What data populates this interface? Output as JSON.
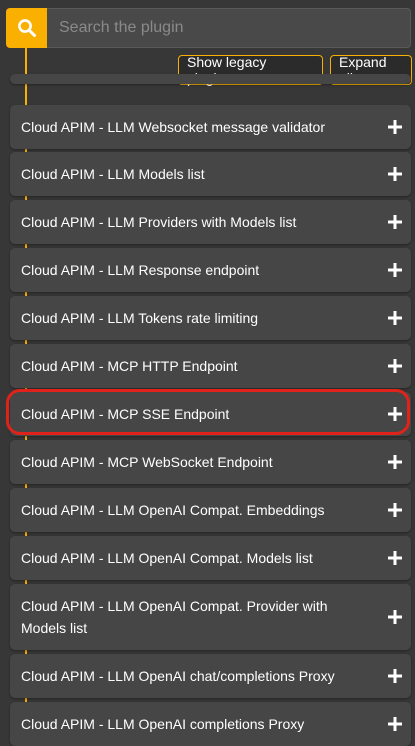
{
  "search": {
    "placeholder": "Search the plugin",
    "value": ""
  },
  "toolbar": {
    "legacy_label": "Show legacy plugins",
    "expand_label": "Expand all"
  },
  "colors": {
    "accent": "#f9b000",
    "background": "#373737",
    "card": "#464646",
    "highlight": "#e0231a"
  },
  "icons": {
    "search": "search-icon",
    "expand": "plus-icon"
  },
  "plugins": [
    {
      "label": "Cloud APIM - LLM Websocket message validator"
    },
    {
      "label": "Cloud APIM - LLM Models list"
    },
    {
      "label": "Cloud APIM - LLM Providers with Models list"
    },
    {
      "label": "Cloud APIM - LLM Response endpoint"
    },
    {
      "label": "Cloud APIM - LLM Tokens rate limiting"
    },
    {
      "label": "Cloud APIM - MCP HTTP Endpoint"
    },
    {
      "label": "Cloud APIM - MCP SSE Endpoint",
      "highlighted": true
    },
    {
      "label": "Cloud APIM - MCP WebSocket Endpoint"
    },
    {
      "label": "Cloud APIM - LLM OpenAI Compat. Embeddings"
    },
    {
      "label": "Cloud APIM - LLM OpenAI Compat. Models list"
    },
    {
      "label": "Cloud APIM - LLM OpenAI Compat. Provider with Models list"
    },
    {
      "label": "Cloud APIM - LLM OpenAI chat/completions Proxy"
    },
    {
      "label": "Cloud APIM - LLM OpenAI completions Proxy"
    }
  ]
}
